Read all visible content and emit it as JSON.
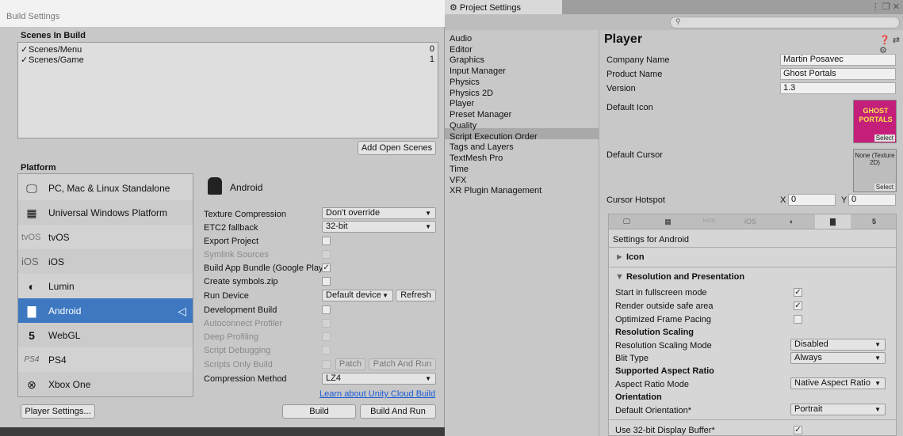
{
  "build_settings": {
    "window_title": "Build Settings",
    "scenes_header": "Scenes In Build",
    "scenes": [
      {
        "name": "Scenes/Menu",
        "index": "0",
        "checked": true
      },
      {
        "name": "Scenes/Game",
        "index": "1",
        "checked": true
      }
    ],
    "add_open_scenes": "Add Open Scenes",
    "platform_header": "Platform",
    "platforms": [
      {
        "label": "PC, Mac & Linux Standalone",
        "icon": "monitor-icon",
        "glyph": "🖵"
      },
      {
        "label": "Universal Windows Platform",
        "icon": "windows-icon",
        "glyph": "▦"
      },
      {
        "label": "tvOS",
        "icon": "tvos-icon",
        "glyph": "tvOS"
      },
      {
        "label": "iOS",
        "icon": "ios-icon",
        "glyph": "iOS"
      },
      {
        "label": "Lumin",
        "icon": "lumin-icon",
        "glyph": "◐"
      },
      {
        "label": "Android",
        "icon": "android-icon",
        "glyph": "▇"
      },
      {
        "label": "WebGL",
        "icon": "html5-icon",
        "glyph": "5"
      },
      {
        "label": "PS4",
        "icon": "ps4-icon",
        "glyph": "PS4"
      },
      {
        "label": "Xbox One",
        "icon": "xbox-icon",
        "glyph": "⊗"
      }
    ],
    "selected_platform": "Android",
    "target_header": "Android",
    "settings": {
      "texture_compression_label": "Texture Compression",
      "texture_compression_value": "Don't override",
      "etc2_fallback_label": "ETC2 fallback",
      "etc2_fallback_value": "32-bit",
      "export_project_label": "Export Project",
      "symlink_sources_label": "Symlink Sources",
      "build_app_bundle_label": "Build App Bundle (Google Play",
      "create_symbols_label": "Create symbols.zip",
      "run_device_label": "Run Device",
      "run_device_value": "Default device",
      "refresh_label": "Refresh",
      "development_build_label": "Development Build",
      "autoconnect_profiler_label": "Autoconnect Profiler",
      "deep_profiling_label": "Deep Profiling",
      "script_debugging_label": "Script Debugging",
      "scripts_only_build_label": "Scripts Only Build",
      "patch_label": "Patch",
      "patch_and_run_label": "Patch And Run",
      "compression_method_label": "Compression Method",
      "compression_method_value": "LZ4"
    },
    "cloud_link": "Learn about Unity Cloud Build",
    "player_settings_btn": "Player Settings...",
    "build_btn": "Build",
    "build_and_run_btn": "Build And Run"
  },
  "project_settings": {
    "tab_title": "Project Settings",
    "window_controls": "⋮ ❐ ✕",
    "nav_items": [
      "Audio",
      "Editor",
      "Graphics",
      "Input Manager",
      "Physics",
      "Physics 2D",
      "Player",
      "Preset Manager",
      "Quality",
      "Script Execution Order",
      "Tags and Layers",
      "TextMesh Pro",
      "Time",
      "VFX",
      "XR Plugin Management"
    ],
    "selected_nav": "Player",
    "page_title": "Player",
    "toolbar_glyphs": "❓ ⇄ ⚙",
    "company_name_label": "Company Name",
    "company_name_value": "Martin Posavec",
    "product_name_label": "Product Name",
    "product_name_value": "Ghost Portals",
    "version_label": "Version",
    "version_value": "1.3",
    "default_icon_label": "Default Icon",
    "icon_text": "GHOST PORTALS",
    "select_label": "Select",
    "default_cursor_label": "Default Cursor",
    "cursor_none_text": "None (Texture 2D)",
    "cursor_hotspot_label": "Cursor Hotspot",
    "hotspot_x_label": "X",
    "hotspot_x_value": "0",
    "hotspot_y_label": "Y",
    "hotspot_y_value": "0",
    "platform_tabs": [
      {
        "name": "standalone",
        "glyph": "🖵"
      },
      {
        "name": "windows",
        "glyph": "▦"
      },
      {
        "name": "tvos",
        "glyph": "tvOS"
      },
      {
        "name": "ios",
        "glyph": "iOS"
      },
      {
        "name": "lumin",
        "glyph": "◐"
      },
      {
        "name": "android",
        "glyph": "▇"
      },
      {
        "name": "webgl",
        "glyph": "5"
      }
    ],
    "settings_for": "Settings for Android",
    "icon_section": "Icon",
    "resolution_section": "Resolution and Presentation",
    "start_fullscreen_label": "Start in fullscreen mode",
    "render_outside_safe_label": "Render outside safe area",
    "optimized_frame_pacing_label": "Optimized Frame Pacing",
    "resolution_scaling_header": "Resolution Scaling",
    "resolution_scaling_mode_label": "Resolution Scaling Mode",
    "resolution_scaling_mode_value": "Disabled",
    "blit_type_label": "Blit Type",
    "blit_type_value": "Always",
    "supported_aspect_header": "Supported Aspect Ratio",
    "aspect_ratio_mode_label": "Aspect Ratio Mode",
    "aspect_ratio_mode_value": "Native Aspect Ratio",
    "orientation_header": "Orientation",
    "default_orientation_label": "Default Orientation*",
    "default_orientation_value": "Portrait",
    "display_buffer_label": "Use 32-bit Display Buffer*"
  }
}
